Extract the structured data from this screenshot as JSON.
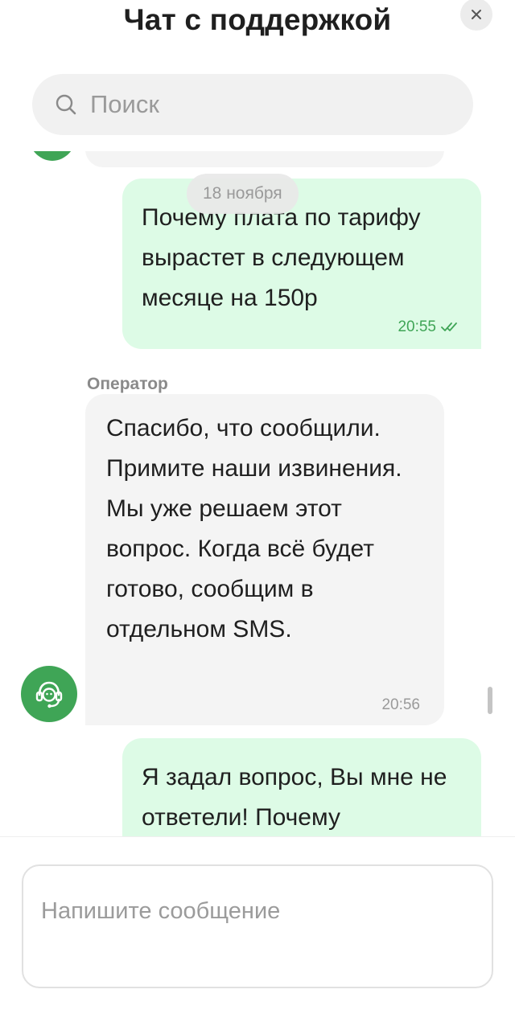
{
  "header": {
    "title": "Чат с поддержкой"
  },
  "search": {
    "placeholder": "Поиск"
  },
  "chat": {
    "date_separator": "18 ноября",
    "messages": [
      {
        "from": "user",
        "text": "Почему плата по тарифу вырастет в следующем месяце на 150р",
        "time": "20:55",
        "status": "read"
      },
      {
        "from": "operator",
        "sender": "Оператор",
        "text": "Спасибо, что сообщили. Примите наши извинения. Мы уже решаем этот вопрос. Когда всё будет готово, сообщим в отдельном SMS.",
        "time": "20:56"
      },
      {
        "from": "user",
        "text": "Я задал вопрос, Вы мне не ответели! Почему"
      }
    ]
  },
  "composer": {
    "placeholder": "Напишите сообщение"
  },
  "colors": {
    "accent": "#3fa556",
    "outgoing_bubble": "#ddfbe6",
    "incoming_bubble": "#f4f4f4"
  }
}
